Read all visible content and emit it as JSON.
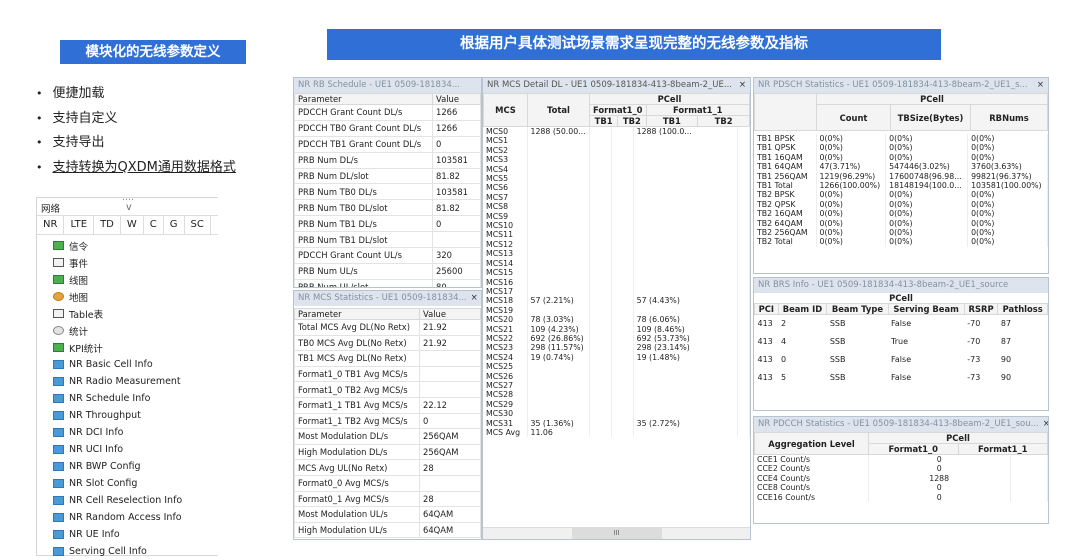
{
  "left_banner": "模块化的无线参数定义",
  "right_banner": "根据用户具体测试场景需求呈现完整的无线参数及指标",
  "bullets": [
    "便捷加载",
    "支持自定义",
    "支持导出",
    "支持转换为QXDM通用数据格式"
  ],
  "tree": {
    "title": "网络",
    "dots": "....",
    "chevron": "v",
    "tabs": [
      "NR",
      "LTE",
      "TD",
      "W",
      "C",
      "G",
      "SC"
    ],
    "items": [
      {
        "label": "信令",
        "icon": "signaling-icon"
      },
      {
        "label": "事件",
        "icon": "event-list-icon"
      },
      {
        "label": "线图",
        "icon": "line-chart-icon"
      },
      {
        "label": "地图",
        "icon": "map-icon"
      },
      {
        "label": "Table表",
        "icon": "table-icon"
      },
      {
        "label": "统计",
        "icon": "statistics-icon"
      },
      {
        "label": "KPI统计",
        "icon": "kpi-icon"
      },
      {
        "label": "NR Basic Cell Info"
      },
      {
        "label": "NR Radio Measurement"
      },
      {
        "label": "NR Schedule Info"
      },
      {
        "label": "NR Throughput"
      },
      {
        "label": "NR DCI Info"
      },
      {
        "label": "NR UCI Info"
      },
      {
        "label": "NR BWP Config"
      },
      {
        "label": "NR Slot Config"
      },
      {
        "label": "NR Cell Reselection Info"
      },
      {
        "label": "NR Random Access Info"
      },
      {
        "label": "NR UE Info"
      },
      {
        "label": "Serving Cell Info"
      }
    ]
  },
  "rb_schedule": {
    "title": "NR RB Schedule - UE1 0509-181834...",
    "close": "×",
    "headers": [
      "Parameter",
      "Value"
    ],
    "rows": [
      [
        "PDCCH Grant Count DL/s",
        "1266"
      ],
      [
        "PDCCH TB0 Grant Count DL/s",
        "1266"
      ],
      [
        "PDCCH TB1 Grant Count DL/s",
        "0"
      ],
      [
        "PRB Num DL/s",
        "103581"
      ],
      [
        "PRB Num DL/slot",
        "81.82"
      ],
      [
        "PRB Num TB0 DL/s",
        "103581"
      ],
      [
        "PRB Num TB0 DL/slot",
        "81.82"
      ],
      [
        "PRB Num TB1 DL/s",
        "0"
      ],
      [
        "PRB Num TB1 DL/slot",
        ""
      ],
      [
        "PDCCH Grant Count UL/s",
        "320"
      ],
      [
        "PRB Num UL/s",
        "25600"
      ],
      [
        "PRB Num UL/slot",
        "80"
      ]
    ]
  },
  "mcs_stats": {
    "title": "NR MCS Statistics - UE1 0509-181834...",
    "close": "×",
    "headers": [
      "Parameter",
      "Value"
    ],
    "rows": [
      [
        "Total MCS Avg DL(No Retx)",
        "21.92"
      ],
      [
        "TB0 MCS Avg DL(No Retx)",
        "21.92"
      ],
      [
        "TB1 MCS Avg DL(No Retx)",
        ""
      ],
      [
        "Format1_0 TB1 Avg MCS/s",
        ""
      ],
      [
        "Format1_0 TB2 Avg MCS/s",
        ""
      ],
      [
        "Format1_1 TB1 Avg MCS/s",
        "22.12"
      ],
      [
        "Format1_1 TB2 Avg MCS/s",
        "0"
      ],
      [
        "Most Modulation DL/s",
        "256QAM"
      ],
      [
        "High Modulation DL/s",
        "256QAM"
      ],
      [
        "MCS Avg UL(No Retx)",
        "28"
      ],
      [
        "Format0_0 Avg MCS/s",
        ""
      ],
      [
        "Format0_1 Avg MCS/s",
        "28"
      ],
      [
        "Most Modulation UL/s",
        "64QAM"
      ],
      [
        "High Modulation UL/s",
        "64QAM"
      ]
    ]
  },
  "mcs_detail": {
    "title": "NR MCS Detail DL - UE1 0509-181834-413-8beam-2_UE...",
    "close": "×",
    "col_mcs": "MCS",
    "col_total": "Total",
    "pcell": "PCell",
    "f10": "Format1_0",
    "f11": "Format1_1",
    "tb1": "TB1",
    "tb2": "TB2",
    "rows": [
      [
        "MCS0",
        "1288 (50.00...",
        "1288 (100.0..."
      ],
      [
        "MCS1",
        "",
        ""
      ],
      [
        "MCS2",
        "",
        ""
      ],
      [
        "MCS3",
        "",
        ""
      ],
      [
        "MCS4",
        "",
        ""
      ],
      [
        "MCS5",
        "",
        ""
      ],
      [
        "MCS6",
        "",
        ""
      ],
      [
        "MCS7",
        "",
        ""
      ],
      [
        "MCS8",
        "",
        ""
      ],
      [
        "MCS9",
        "",
        ""
      ],
      [
        "MCS10",
        "",
        ""
      ],
      [
        "MCS11",
        "",
        ""
      ],
      [
        "MCS12",
        "",
        ""
      ],
      [
        "MCS13",
        "",
        ""
      ],
      [
        "MCS14",
        "",
        ""
      ],
      [
        "MCS15",
        "",
        ""
      ],
      [
        "MCS16",
        "",
        ""
      ],
      [
        "MCS17",
        "",
        ""
      ],
      [
        "MCS18",
        "57 (2.21%)",
        "57 (4.43%)"
      ],
      [
        "MCS19",
        "",
        ""
      ],
      [
        "MCS20",
        "78 (3.03%)",
        "78 (6.06%)"
      ],
      [
        "MCS21",
        "109 (4.23%)",
        "109 (8.46%)"
      ],
      [
        "MCS22",
        "692 (26.86%)",
        "692 (53.73%)"
      ],
      [
        "MCS23",
        "298 (11.57%)",
        "298 (23.14%)"
      ],
      [
        "MCS24",
        "19 (0.74%)",
        "19 (1.48%)"
      ],
      [
        "MCS25",
        "",
        ""
      ],
      [
        "MCS26",
        "",
        ""
      ],
      [
        "MCS27",
        "",
        ""
      ],
      [
        "MCS28",
        "",
        ""
      ],
      [
        "MCS29",
        "",
        ""
      ],
      [
        "MCS30",
        "",
        ""
      ],
      [
        "MCS31",
        "35 (1.36%)",
        "35 (2.72%)"
      ],
      [
        "MCS Avg",
        "11.06",
        ""
      ]
    ],
    "scroll": "III"
  },
  "pdsch": {
    "title": "NR PDSCH Statistics - UE1 0509-181834-413-8beam-2_UE1_s...",
    "close": "×",
    "pcell": "PCell",
    "headers": [
      "Count",
      "TBSize(Bytes)",
      "RBNums"
    ],
    "rows": [
      [
        "TB1 BPSK",
        "0(0%)",
        "0(0%)",
        "0(0%)"
      ],
      [
        "TB1 QPSK",
        "0(0%)",
        "0(0%)",
        "0(0%)"
      ],
      [
        "TB1 16QAM",
        "0(0%)",
        "0(0%)",
        "0(0%)"
      ],
      [
        "TB1 64QAM",
        "47(3.71%)",
        "547446(3.02%)",
        "3760(3.63%)"
      ],
      [
        "TB1 256QAM",
        "1219(96.29%)",
        "17600748(96.98...",
        "99821(96.37%)"
      ],
      [
        "TB1 Total",
        "1266(100.00%)",
        "18148194(100.0...",
        "103581(100.00%)"
      ],
      [
        "TB2 BPSK",
        "0(0%)",
        "0(0%)",
        "0(0%)"
      ],
      [
        "TB2 QPSK",
        "0(0%)",
        "0(0%)",
        "0(0%)"
      ],
      [
        "TB2 16QAM",
        "0(0%)",
        "0(0%)",
        "0(0%)"
      ],
      [
        "TB2 64QAM",
        "0(0%)",
        "0(0%)",
        "0(0%)"
      ],
      [
        "TB2 256QAM",
        "0(0%)",
        "0(0%)",
        "0(0%)"
      ],
      [
        "TB2 Total",
        "0(0%)",
        "0(0%)",
        "0(0%)"
      ]
    ]
  },
  "brs": {
    "title": "NR BRS Info - UE1 0509-181834-413-8beam-2_UE1_source",
    "pcell": "PCell",
    "headers": [
      "PCI",
      "Beam ID",
      "Beam Type",
      "Serving Beam",
      "RSRP",
      "Pathloss"
    ],
    "rows": [
      [
        "413",
        "2",
        "SSB",
        "False",
        "-70",
        "87"
      ],
      [
        "413",
        "4",
        "SSB",
        "True",
        "-70",
        "87"
      ],
      [
        "413",
        "0",
        "SSB",
        "False",
        "-73",
        "90"
      ],
      [
        "413",
        "5",
        "SSB",
        "False",
        "-73",
        "90"
      ]
    ]
  },
  "pdcch": {
    "title": "NR PDCCH Statistics - UE1 0509-181834-413-8beam-2_UE1_sou...",
    "close": "×",
    "agg": "Aggregation Level",
    "pcell": "PCell",
    "f10": "Format1_0",
    "f11": "Format1_1",
    "rows": [
      [
        "CCE1 Count/s",
        "0"
      ],
      [
        "CCE2 Count/s",
        "0"
      ],
      [
        "CCE4 Count/s",
        "1288"
      ],
      [
        "CCE8 Count/s",
        "0"
      ],
      [
        "CCE16 Count/s",
        "0"
      ]
    ]
  }
}
